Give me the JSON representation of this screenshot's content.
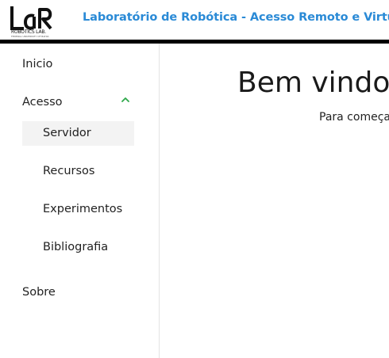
{
  "header": {
    "logo_text": "LaR",
    "logo_subtitle": "ROBOTICS LAB.",
    "logo_tagline": "FEDERAL UNIVERSITY OF BAHIA",
    "title": "Laboratório de Robótica - Acesso Remoto e Virtual"
  },
  "sidebar": {
    "inicio": "Inicio",
    "acesso": "Acesso",
    "servidor": "Servidor",
    "recursos": "Recursos",
    "experimentos": "Experimentos",
    "bibliografia": "Bibliografia",
    "sobre": "Sobre"
  },
  "main": {
    "title": "Bem vindo",
    "subtitle": "Para começa"
  },
  "colors": {
    "title_blue": "#2a8ad6",
    "chevron_green": "#2ea84a"
  }
}
